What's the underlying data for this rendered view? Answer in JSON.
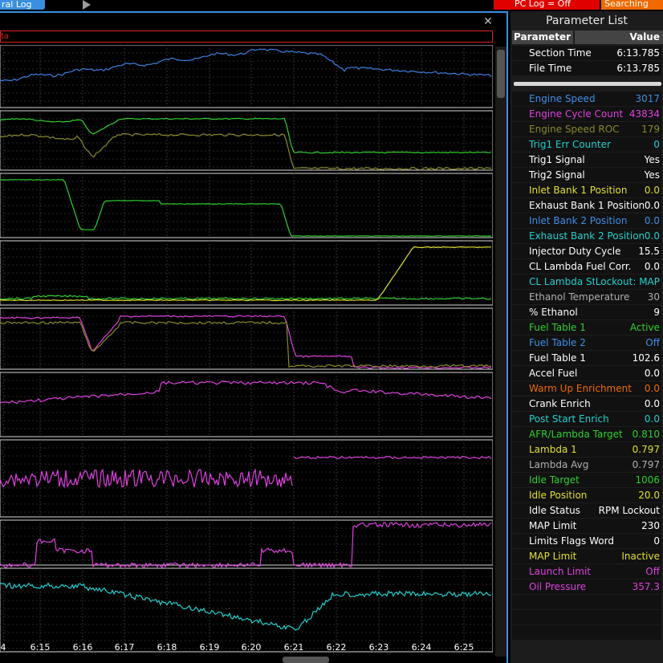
{
  "topbar": {
    "tab_label": "ral Log",
    "pc_log_label": "PC Log = Off",
    "searching_label": "Searching",
    "colors": {
      "tab": "#3a8fe0",
      "pc_log": "#e00000",
      "searching": "#f06a00"
    }
  },
  "plot": {
    "close_icon": "close-icon",
    "channel_label": "ta",
    "time_ticks": [
      "4",
      "6:15",
      "6:16",
      "6:17",
      "6:18",
      "6:19",
      "6:20",
      "6:21",
      "6:22",
      "6:23",
      "6:24",
      "6:25"
    ]
  },
  "panel": {
    "title": "Parameter List",
    "col_name": "Parameter",
    "col_value": "Value",
    "time_rows": [
      {
        "name": "Section Time",
        "value": "6:13.785",
        "color": "#ffffff"
      },
      {
        "name": "File Time",
        "value": "6:13.785",
        "color": "#ffffff"
      }
    ],
    "params": [
      {
        "name": "Engine Speed",
        "value": "3017",
        "color": "#3d8fe8"
      },
      {
        "name": "Engine Cycle Count",
        "value": "43834",
        "color": "#e040e0"
      },
      {
        "name": "Engine Speed ROC",
        "value": "179",
        "color": "#8a8a2a"
      },
      {
        "name": "Trig1 Err Counter",
        "value": "0",
        "color": "#20d0d0"
      },
      {
        "name": "Trig1 Signal",
        "value": "Yes",
        "color": "#ffffff"
      },
      {
        "name": "Trig2 Signal",
        "value": "Yes",
        "color": "#ffffff"
      },
      {
        "name": "Inlet Bank 1 Position",
        "value": "0.0",
        "color": "#e0e030"
      },
      {
        "name": "Exhaust Bank 1 Position",
        "value": "0.0",
        "color": "#ffffff"
      },
      {
        "name": "Inlet Bank 2 Position",
        "value": "0.0",
        "color": "#3d8fe8"
      },
      {
        "name": "Exhaust Bank 2 Position",
        "value": "0.0",
        "color": "#20d0d0"
      },
      {
        "name": "Injector Duty Cycle",
        "value": "15.5",
        "color": "#ffffff"
      },
      {
        "name": "CL Lambda  Fuel  Corr.",
        "value": "0.0",
        "color": "#ffffff"
      },
      {
        "name": "CL Lambda Statu",
        "value": "Lockout: MAP",
        "color": "#20d0d0"
      },
      {
        "name": "Ethanol Temperature",
        "value": "30",
        "color": "#b0b0b0"
      },
      {
        "name": "% Ethanol",
        "value": "9",
        "color": "#ffffff"
      },
      {
        "name": "Fuel Table 1",
        "value": "Active",
        "color": "#30d030"
      },
      {
        "name": "Fuel Table 2",
        "value": "Off",
        "color": "#3d8fe8"
      },
      {
        "name": "Fuel Table 1",
        "value": "102.6",
        "color": "#ffffff"
      },
      {
        "name": "Accel Fuel",
        "value": "0.0",
        "color": "#ffffff"
      },
      {
        "name": "Warm Up Enrichment",
        "value": "0.0",
        "color": "#f06a00"
      },
      {
        "name": "Crank Enrich",
        "value": "0.0",
        "color": "#ffffff"
      },
      {
        "name": "Post Start Enrich",
        "value": "0.0",
        "color": "#20d0d0"
      },
      {
        "name": "AFR/Lambda Target",
        "value": "0.810",
        "color": "#30d030"
      },
      {
        "name": "Lambda 1",
        "value": "0.797",
        "color": "#e0e030"
      },
      {
        "name": "Lambda Avg",
        "value": "0.797",
        "color": "#b0b0b0"
      },
      {
        "name": "Idle Target",
        "value": "1006",
        "color": "#30d030"
      },
      {
        "name": "Idle Position",
        "value": "20.0",
        "color": "#e0e030"
      },
      {
        "name": "Idle Status",
        "value": "RPM Lockout",
        "color": "#ffffff"
      },
      {
        "name": "MAP Limit",
        "value": "230",
        "color": "#ffffff"
      },
      {
        "name": "Limits Flags Word",
        "value": "0",
        "color": "#ffffff"
      },
      {
        "name": "MAP Limit",
        "value": "Inactive",
        "color": "#e0e030"
      },
      {
        "name": "Launch Limit",
        "value": "Off",
        "color": "#e040e0"
      },
      {
        "name": "Oil Pressure",
        "value": "357.3",
        "color": "#e040e0"
      }
    ]
  }
}
